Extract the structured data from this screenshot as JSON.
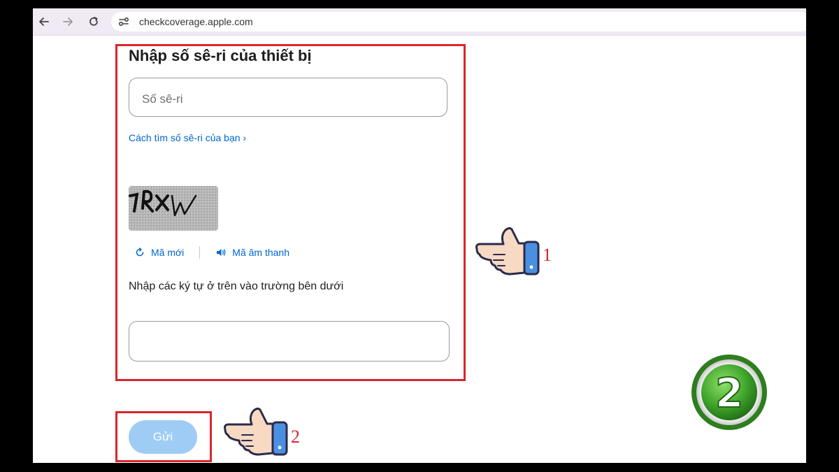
{
  "browser": {
    "url": "checkcoverage.apple.com",
    "icons": [
      "back-arrow-icon",
      "forward-arrow-icon",
      "reload-icon",
      "site-info-icon"
    ]
  },
  "form": {
    "title": "Nhập số sê-ri của thiết bị",
    "serial_placeholder": "Số sê-ri",
    "serial_value": "",
    "find_serial_link": "Cách tìm số sê-ri của bạn ›",
    "captcha_text": "1RXW",
    "new_code_label": "Mã mới",
    "audio_code_label": "Mã âm thanh",
    "instruction": "Nhập các ký tự ở trên vào trường bên dưới",
    "captcha_value": "",
    "submit_label": "Gửi"
  },
  "annotations": {
    "step1": "1",
    "step2": "2",
    "badge": "2",
    "highlight_color": "#d7262e",
    "badge_color": "#4caf2e"
  },
  "colors": {
    "link": "#0066cc",
    "submit_bg": "#9fccf4"
  }
}
